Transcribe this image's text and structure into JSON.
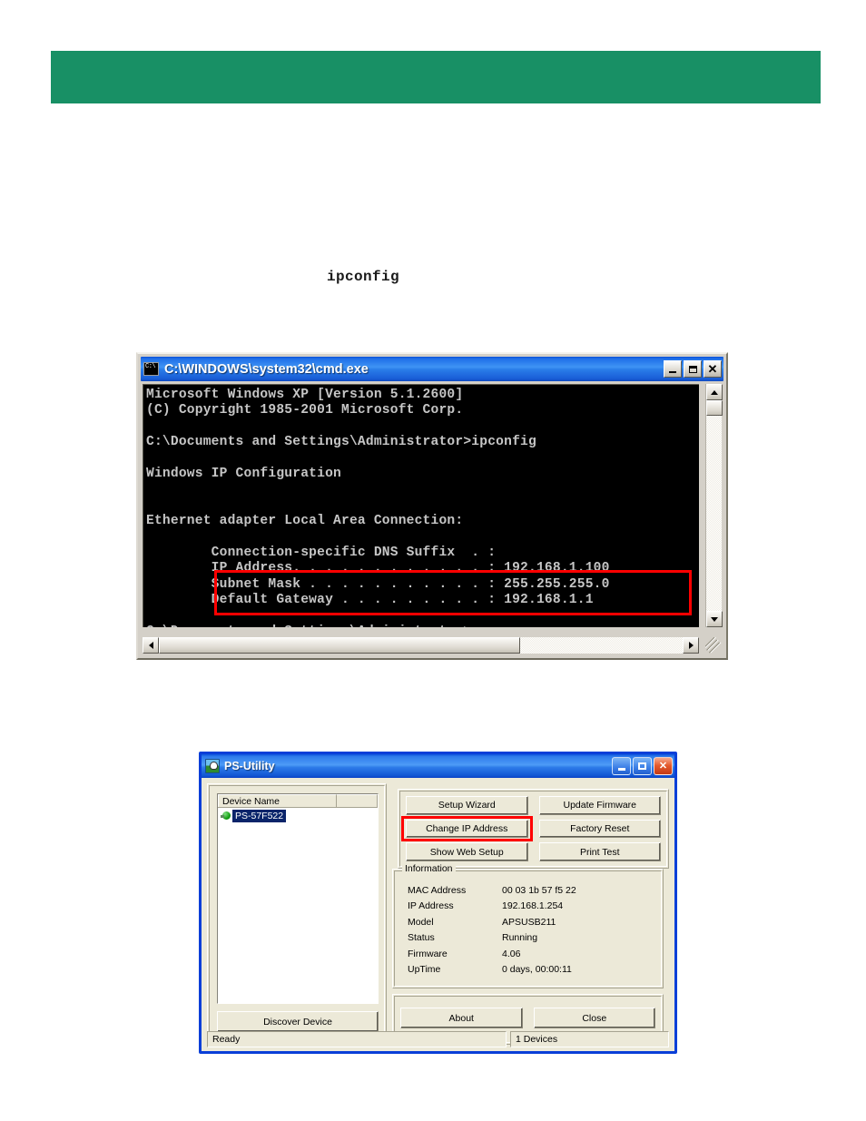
{
  "page": {
    "header_band_color": "#189065",
    "inline_command": "ipconfig"
  },
  "cmd_window": {
    "title": "C:\\WINDOWS\\system32\\cmd.exe",
    "icon": "console-icon",
    "titlebar_color": "#2a7de9",
    "minimize_label": "_",
    "maximize_label": "□",
    "close_label": "✕",
    "terminal": {
      "background": "#000000",
      "foreground": "#c6c6c6",
      "lines": [
        "Microsoft Windows XP [Version 5.1.2600]",
        "(C) Copyright 1985-2001 Microsoft Corp.",
        "",
        "C:\\Documents and Settings\\Administrator>ipconfig",
        "",
        "Windows IP Configuration",
        "",
        "",
        "Ethernet adapter Local Area Connection:",
        "",
        "        Connection-specific DNS Suffix  . :",
        "        IP Address. . . . . . . . . . . . : 192.168.1.100",
        "        Subnet Mask . . . . . . . . . . . : 255.255.255.0",
        "        Default Gateway . . . . . . . . . : 192.168.1.1",
        "",
        "C:\\Documents and Settings\\Administrator>"
      ],
      "highlight_color": "#ff0000",
      "highlighted_lines": [
        "IP Address. . . . . . . . . . . . : 192.168.1.100",
        "Subnet Mask . . . . . . . . . . . : 255.255.255.0",
        "Default Gateway . . . . . . . . . : 192.168.1.1"
      ]
    }
  },
  "ps_utility": {
    "title": "PS-Utility",
    "icon": "ps-utility-icon",
    "minimize_label": "_",
    "restore_label": "□",
    "close_label": "✕",
    "border_color": "#0a3fd8",
    "device_list": {
      "column_header": "Device Name",
      "items": [
        {
          "name": "PS-57F522",
          "selected": true,
          "status_icon": "green-plug-icon"
        }
      ]
    },
    "discover_button": "Discover Device",
    "action_buttons": [
      {
        "label": "Setup Wizard",
        "highlighted": false
      },
      {
        "label": "Update Firmware",
        "highlighted": false
      },
      {
        "label": "Change IP Address",
        "highlighted": true
      },
      {
        "label": "Factory Reset",
        "highlighted": false
      },
      {
        "label": "Show Web Setup",
        "highlighted": false
      },
      {
        "label": "Print Test",
        "highlighted": false
      }
    ],
    "information": {
      "legend": "Information",
      "rows": [
        {
          "key": "MAC Address",
          "value": "00 03 1b 57 f5 22"
        },
        {
          "key": "IP Address",
          "value": "192.168.1.254"
        },
        {
          "key": "Model",
          "value": "APSUSB211"
        },
        {
          "key": "Status",
          "value": "Running"
        },
        {
          "key": "Firmware",
          "value": "4.06"
        },
        {
          "key": "UpTime",
          "value": "0 days, 00:00:11"
        }
      ]
    },
    "about_button": "About",
    "close_button": "Close",
    "status_bar": {
      "left": "Ready",
      "right": "1 Devices"
    }
  }
}
